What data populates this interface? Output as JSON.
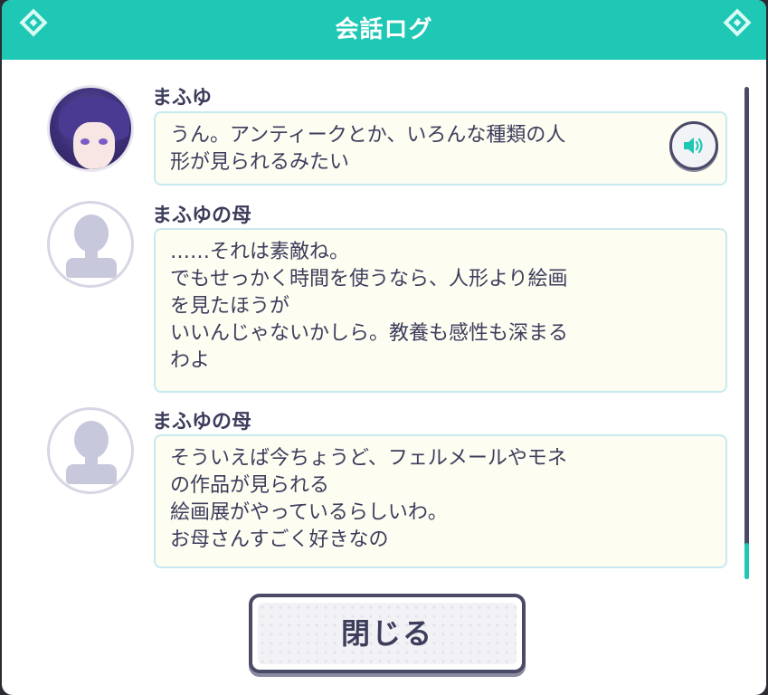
{
  "header": {
    "title": "会話ログ"
  },
  "log": [
    {
      "speaker": "まふゆ",
      "text": "うん。アンティークとか、いろんな種類の人\n形が見られるみたい",
      "has_voice": true,
      "avatar": "character-portrait"
    },
    {
      "speaker": "まふゆの母",
      "text": "……それは素敵ね。\nでもせっかく時間を使うなら、人形より絵画\nを見たほうが\nいいんじゃないかしら。教養も感性も深まる\nわよ",
      "has_voice": false,
      "avatar": "placeholder-silhouette"
    },
    {
      "speaker": "まふゆの母",
      "text": "そういえば今ちょうど、フェルメールやモネ\nの作品が見られる\n絵画展がやっているらしいわ。\nお母さんすごく好きなの",
      "has_voice": false,
      "avatar": "placeholder-silhouette"
    }
  ],
  "close_button": {
    "label": "閉じる"
  },
  "colors": {
    "accent": "#1fc7b5",
    "text": "#3d3d5c",
    "bubble_bg": "#fdfdf2",
    "bubble_border": "#c7eaef"
  },
  "icons": {
    "voice": "speaker-icon",
    "header_decoration": "diamond-icon"
  }
}
